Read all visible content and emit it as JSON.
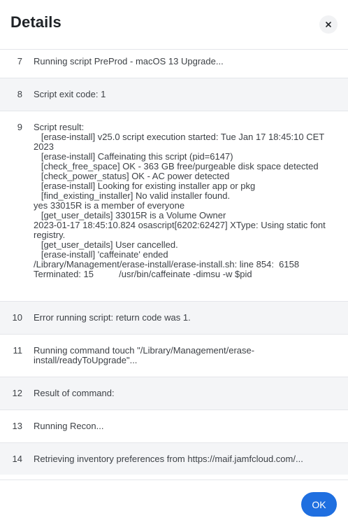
{
  "dialog": {
    "title": "Details",
    "ok_label": "OK"
  },
  "rows": [
    {
      "num": "7",
      "text": "Running script PreProd - macOS 13 Upgrade..."
    },
    {
      "num": "8",
      "text": "Script exit code: 1"
    },
    {
      "num": "9",
      "text": "Script result:\n   [erase-install] v25.0 script execution started: Tue Jan 17 18:45:10 CET 2023\n   [erase-install] Caffeinating this script (pid=6147)\n   [check_free_space] OK - 363 GB free/purgeable disk space detected\n   [check_power_status] OK - AC power detected\n   [erase-install] Looking for existing installer app or pkg\n   [find_existing_installer] No valid installer found.\nyes 33015R is a member of everyone\n   [get_user_details] 33015R is a Volume Owner\n2023-01-17 18:45:10.824 osascript[6202:62427] XType: Using static font registry.\n   [get_user_details] User cancelled.\n   [erase-install] 'caffeinate' ended\n/Library/Management/erase-install/erase-install.sh: line 854:  6158 Terminated: 15          /usr/bin/caffeinate -dimsu -w $pid"
    },
    {
      "num": "10",
      "text": "Error running script: return code was 1."
    },
    {
      "num": "11",
      "text": "Running command touch \"/Library/Management/erase-install/readyToUpgrade\"..."
    },
    {
      "num": "12",
      "text": "Result of command:"
    },
    {
      "num": "13",
      "text": "Running Recon..."
    },
    {
      "num": "14",
      "text": "Retrieving inventory preferences from https://maif.jamfcloud.com/..."
    }
  ]
}
